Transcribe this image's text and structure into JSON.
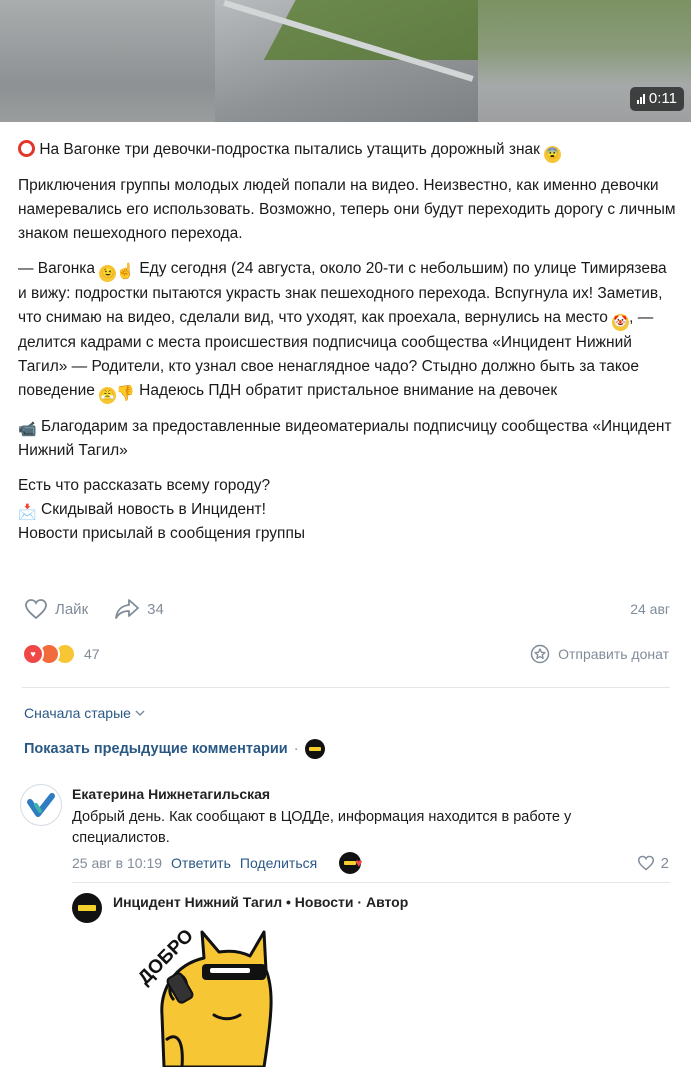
{
  "video": {
    "duration": "0:11"
  },
  "post": {
    "headline": "На Вагонке три девочки-подростка пытались утащить дорожный знак",
    "paragraph1": "Приключения группы молодых людей попали на видео. Неизвестно, как именно девочки намеревались его использовать. Возможно, теперь они будут переходить дорогу с личным знаком пешеходного перехода.",
    "quote_part1": "— Вагонка",
    "quote_part2": "Еду сегодня (24 августа, около 20-ти с небольшим) по улице Тимирязева и вижу: подростки пытаются украсть знак пешеходного перехода. Вспугнула их! Заметив, что снимаю на видео, сделали вид, что уходят, как проехала, вернулись на место",
    "quote_part3": ", — делится кадрами с места происшествия подписчица сообщества «Инцидент Нижний Тагил» — Родители, кто узнал свое ненаглядное чадо? Стыдно должно быть за такое поведение",
    "quote_part4": "Надеюсь ПДН обратит пристальное внимание на девочек",
    "thanks": "Благодарим за предоставленные видеоматериалы подписчицу сообщества «Инцидент Нижний Тагил»",
    "cta1": "Есть что рассказать всему городу?",
    "cta2": "Скидывай новость в Инцидент!",
    "cta3": "Новости присылай в сообщения группы"
  },
  "actions": {
    "like_label": "Лайк",
    "share_count": "34",
    "date": "24 авг",
    "reactions_count": "47",
    "donate_label": "Отправить донат"
  },
  "comments": {
    "sort_label": "Сначала старые",
    "show_previous": "Показать предыдущие комментарии",
    "first": {
      "author": "Екатерина Нижнетагильская",
      "text": "Добрый день. Как сообщают в ЦОДДе, информация находится в работе у специалистов.",
      "time": "25 авг в 10:19",
      "reply": "Ответить",
      "share": "Поделиться",
      "likes": "2"
    },
    "reply": {
      "author": "Инцидент Нижний Тагил • Новости",
      "badge": "· Автор",
      "sticker_text": "ДОБРО"
    }
  },
  "colors": {
    "link": "#2a5885",
    "muted": "#818c99",
    "accent_red": "#e2372b",
    "sticker_yellow": "#f7c634"
  }
}
